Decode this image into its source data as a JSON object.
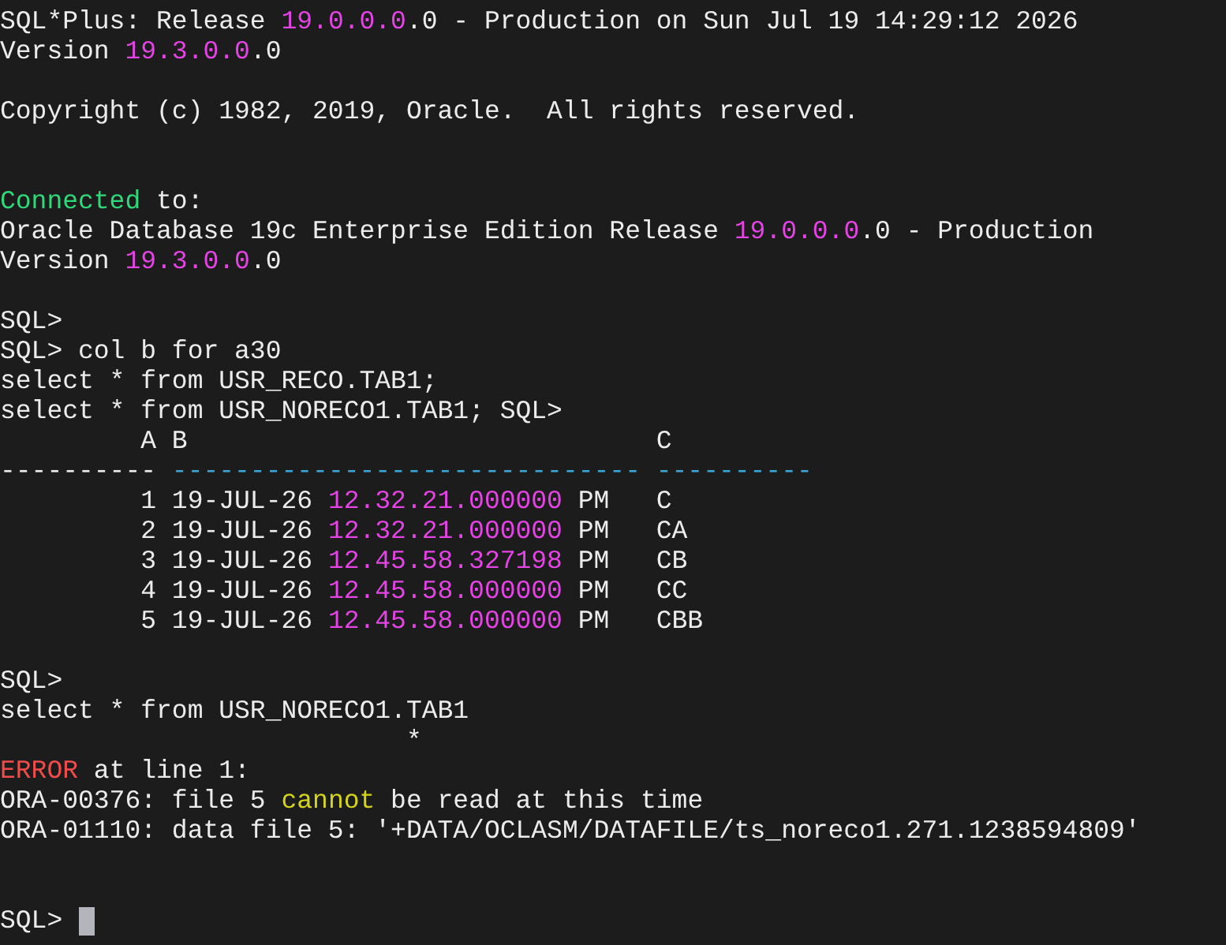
{
  "terminal": {
    "lines": [
      {
        "kind": "text",
        "segments": [
          {
            "text": "SQL*Plus: Release "
          },
          {
            "text": "19.0.0.0",
            "color": "#e444e4"
          },
          {
            "text": ".0 - Production on Sun Jul 19 14:29:12 2026"
          }
        ]
      },
      {
        "kind": "text",
        "segments": [
          {
            "text": "Version "
          },
          {
            "text": "19.3.0.0",
            "color": "#e444e4"
          },
          {
            "text": ".0"
          }
        ]
      },
      {
        "kind": "blank"
      },
      {
        "kind": "text",
        "segments": [
          {
            "text": "Copyright (c) 1982, 2019, Oracle.  All rights reserved."
          }
        ]
      },
      {
        "kind": "blank"
      },
      {
        "kind": "blank"
      },
      {
        "kind": "text",
        "segments": [
          {
            "text": "Connected",
            "color": "#2fd97a"
          },
          {
            "text": " to:"
          }
        ]
      },
      {
        "kind": "text",
        "segments": [
          {
            "text": "Oracle Database 19c Enterprise Edition Release "
          },
          {
            "text": "19.0.0.0",
            "color": "#e444e4"
          },
          {
            "text": ".0 - Production"
          }
        ]
      },
      {
        "kind": "text",
        "segments": [
          {
            "text": "Version "
          },
          {
            "text": "19.3.0.0",
            "color": "#e444e4"
          },
          {
            "text": ".0"
          }
        ]
      },
      {
        "kind": "blank"
      },
      {
        "kind": "text",
        "segments": [
          {
            "text": "SQL>"
          }
        ]
      },
      {
        "kind": "text",
        "segments": [
          {
            "text": "SQL> col b for a30"
          }
        ]
      },
      {
        "kind": "text",
        "segments": [
          {
            "text": "select * from USR_RECO.TAB1;"
          }
        ]
      },
      {
        "kind": "text",
        "segments": [
          {
            "text": "select * from USR_NORECO1.TAB1; SQL>"
          }
        ]
      },
      {
        "kind": "text",
        "segments": [
          {
            "text": "         A B                              C"
          }
        ]
      },
      {
        "kind": "text",
        "segments": [
          {
            "text": "---------- "
          },
          {
            "text": "------------------------------ ----------",
            "color": "#3aa6d8"
          }
        ]
      },
      {
        "kind": "text",
        "segments": [
          {
            "text": "         1 19-JUL-26 "
          },
          {
            "text": "12.32.21.000000",
            "color": "#e444e4"
          },
          {
            "text": " PM   C"
          }
        ]
      },
      {
        "kind": "text",
        "segments": [
          {
            "text": "         2 19-JUL-26 "
          },
          {
            "text": "12.32.21.000000",
            "color": "#e444e4"
          },
          {
            "text": " PM   CA"
          }
        ]
      },
      {
        "kind": "text",
        "segments": [
          {
            "text": "         3 19-JUL-26 "
          },
          {
            "text": "12.45.58.327198",
            "color": "#e444e4"
          },
          {
            "text": " PM   CB"
          }
        ]
      },
      {
        "kind": "text",
        "segments": [
          {
            "text": "         4 19-JUL-26 "
          },
          {
            "text": "12.45.58.000000",
            "color": "#e444e4"
          },
          {
            "text": " PM   CC"
          }
        ]
      },
      {
        "kind": "text",
        "segments": [
          {
            "text": "         5 19-JUL-26 "
          },
          {
            "text": "12.45.58.000000",
            "color": "#e444e4"
          },
          {
            "text": " PM   CBB"
          }
        ]
      },
      {
        "kind": "blank"
      },
      {
        "kind": "text",
        "segments": [
          {
            "text": "SQL>"
          }
        ]
      },
      {
        "kind": "text",
        "segments": [
          {
            "text": "select * from USR_NORECO1.TAB1"
          }
        ]
      },
      {
        "kind": "text",
        "segments": [
          {
            "text": "                          *"
          }
        ]
      },
      {
        "kind": "text",
        "segments": [
          {
            "text": "ERROR",
            "color": "#f04c4c"
          },
          {
            "text": " at line 1:"
          }
        ]
      },
      {
        "kind": "text",
        "segments": [
          {
            "text": "ORA-00376: file 5 "
          },
          {
            "text": "cannot",
            "color": "#d4d41a"
          },
          {
            "text": " be read at this time"
          }
        ]
      },
      {
        "kind": "text",
        "segments": [
          {
            "text": "ORA-01110: data file 5: '+DATA/OCLASM/DATAFILE/ts_noreco1.271.1238594809'"
          }
        ]
      },
      {
        "kind": "blank"
      },
      {
        "kind": "blank"
      },
      {
        "kind": "text",
        "segments": [
          {
            "text": "SQL> "
          }
        ],
        "cursor": true
      }
    ]
  }
}
